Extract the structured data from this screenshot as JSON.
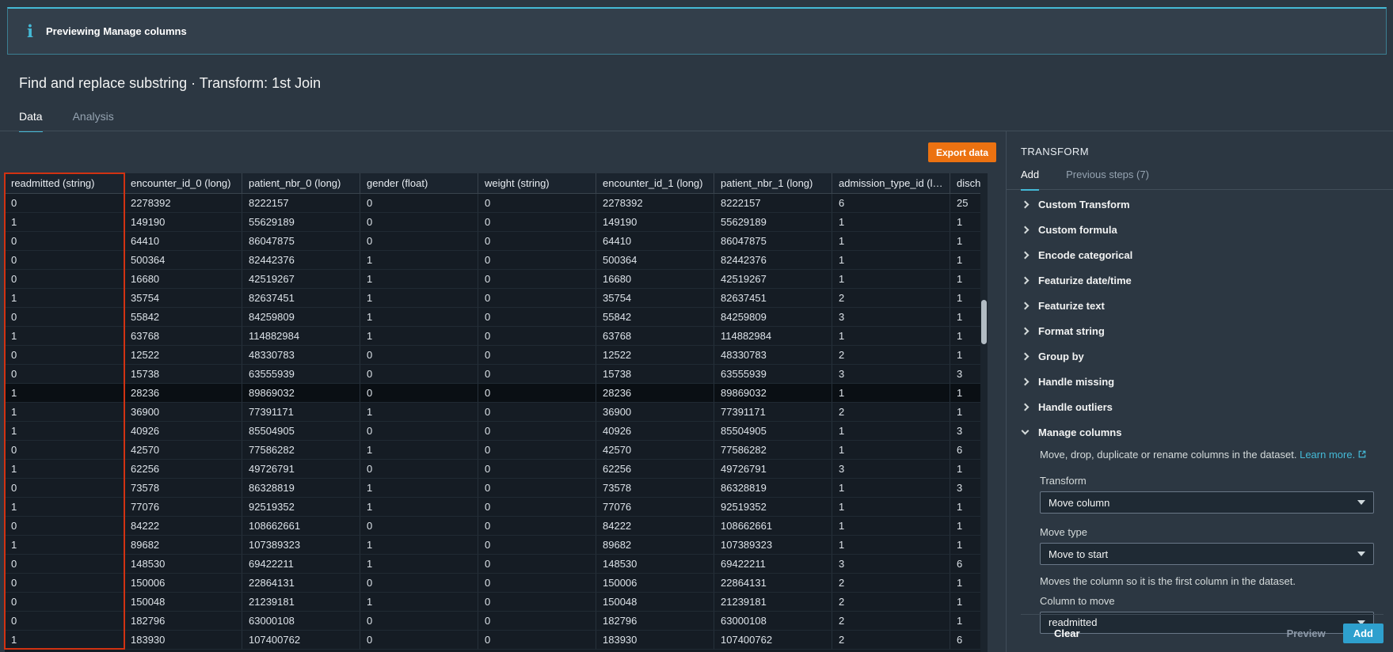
{
  "banner": {
    "icon": "i",
    "text": "Previewing Manage columns"
  },
  "header": {
    "title": "Find and replace substring · Transform: 1st Join",
    "tabs": [
      {
        "label": "Data",
        "active": true
      },
      {
        "label": "Analysis",
        "active": false
      }
    ]
  },
  "toolbar": {
    "export_label": "Export data"
  },
  "table": {
    "columns": [
      "readmitted (string)",
      "encounter_id_0 (long)",
      "patient_nbr_0 (long)",
      "gender (float)",
      "weight (string)",
      "encounter_id_1 (long)",
      "patient_nbr_1 (long)",
      "admission_type_id (lo...",
      "dischar"
    ],
    "highlighted_row_index": 10,
    "highlighted_column_index": 0,
    "rows": [
      [
        "0",
        "2278392",
        "8222157",
        "0",
        "0",
        "2278392",
        "8222157",
        "6",
        "25"
      ],
      [
        "1",
        "149190",
        "55629189",
        "0",
        "0",
        "149190",
        "55629189",
        "1",
        "1"
      ],
      [
        "0",
        "64410",
        "86047875",
        "0",
        "0",
        "64410",
        "86047875",
        "1",
        "1"
      ],
      [
        "0",
        "500364",
        "82442376",
        "1",
        "0",
        "500364",
        "82442376",
        "1",
        "1"
      ],
      [
        "0",
        "16680",
        "42519267",
        "1",
        "0",
        "16680",
        "42519267",
        "1",
        "1"
      ],
      [
        "1",
        "35754",
        "82637451",
        "1",
        "0",
        "35754",
        "82637451",
        "2",
        "1"
      ],
      [
        "0",
        "55842",
        "84259809",
        "1",
        "0",
        "55842",
        "84259809",
        "3",
        "1"
      ],
      [
        "1",
        "63768",
        "114882984",
        "1",
        "0",
        "63768",
        "114882984",
        "1",
        "1"
      ],
      [
        "0",
        "12522",
        "48330783",
        "0",
        "0",
        "12522",
        "48330783",
        "2",
        "1"
      ],
      [
        "0",
        "15738",
        "63555939",
        "0",
        "0",
        "15738",
        "63555939",
        "3",
        "3"
      ],
      [
        "1",
        "28236",
        "89869032",
        "0",
        "0",
        "28236",
        "89869032",
        "1",
        "1"
      ],
      [
        "1",
        "36900",
        "77391171",
        "1",
        "0",
        "36900",
        "77391171",
        "2",
        "1"
      ],
      [
        "1",
        "40926",
        "85504905",
        "0",
        "0",
        "40926",
        "85504905",
        "1",
        "3"
      ],
      [
        "0",
        "42570",
        "77586282",
        "1",
        "0",
        "42570",
        "77586282",
        "1",
        "6"
      ],
      [
        "1",
        "62256",
        "49726791",
        "0",
        "0",
        "62256",
        "49726791",
        "3",
        "1"
      ],
      [
        "0",
        "73578",
        "86328819",
        "1",
        "0",
        "73578",
        "86328819",
        "1",
        "3"
      ],
      [
        "1",
        "77076",
        "92519352",
        "1",
        "0",
        "77076",
        "92519352",
        "1",
        "1"
      ],
      [
        "0",
        "84222",
        "108662661",
        "0",
        "0",
        "84222",
        "108662661",
        "1",
        "1"
      ],
      [
        "1",
        "89682",
        "107389323",
        "1",
        "0",
        "89682",
        "107389323",
        "1",
        "1"
      ],
      [
        "0",
        "148530",
        "69422211",
        "1",
        "0",
        "148530",
        "69422211",
        "3",
        "6"
      ],
      [
        "0",
        "150006",
        "22864131",
        "0",
        "0",
        "150006",
        "22864131",
        "2",
        "1"
      ],
      [
        "0",
        "150048",
        "21239181",
        "1",
        "0",
        "150048",
        "21239181",
        "2",
        "1"
      ],
      [
        "0",
        "182796",
        "63000108",
        "0",
        "0",
        "182796",
        "63000108",
        "2",
        "1"
      ],
      [
        "1",
        "183930",
        "107400762",
        "0",
        "0",
        "183930",
        "107400762",
        "2",
        "6"
      ]
    ]
  },
  "transform_panel": {
    "title": "TRANSFORM",
    "tabs": [
      {
        "label": "Add",
        "active": true
      },
      {
        "label": "Previous steps (7)",
        "active": false
      }
    ],
    "items": [
      "Custom Transform",
      "Custom formula",
      "Encode categorical",
      "Featurize date/time",
      "Featurize text",
      "Format string",
      "Group by",
      "Handle missing",
      "Handle outliers"
    ],
    "expanded_item": "Manage columns",
    "manage_columns": {
      "description": "Move, drop, duplicate or rename columns in the dataset.",
      "learn_more": "Learn more.",
      "fields": [
        {
          "label": "Transform",
          "value": "Move column"
        },
        {
          "label": "Move type",
          "value": "Move to start",
          "help": "Moves the column so it is the first column in the dataset."
        },
        {
          "label": "Column to move",
          "value": "readmitted"
        }
      ]
    },
    "footer": {
      "clear": "Clear",
      "preview": "Preview",
      "add": "Add"
    }
  },
  "colors": {
    "accent_teal": "#44b9d6",
    "highlight_red": "#d13212",
    "export_orange": "#ec7211",
    "add_button_blue": "#2ea0ce"
  }
}
